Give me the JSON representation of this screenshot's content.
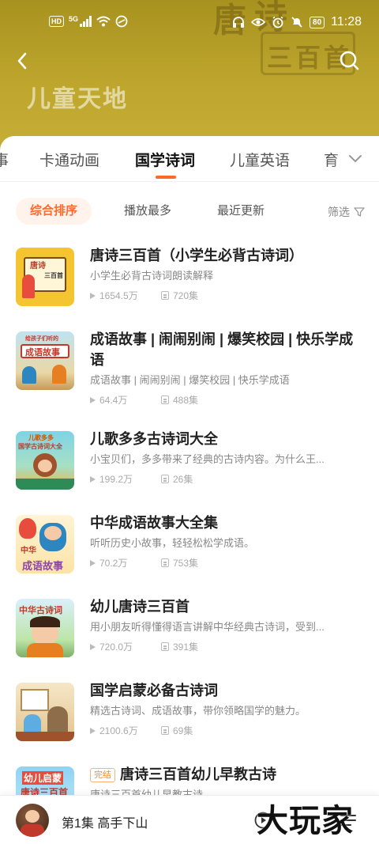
{
  "status_bar": {
    "network_badge": "HD",
    "network_type": "5G",
    "battery": "80",
    "time": "11:28"
  },
  "header": {
    "title": "儿童天地",
    "art_chars": [
      "唐",
      "诗",
      "三",
      "百",
      "首"
    ]
  },
  "tabs": {
    "items": [
      "事",
      "卡通动画",
      "国学诗词",
      "儿童英语",
      "育"
    ],
    "active": "国学诗词"
  },
  "sort": {
    "options": [
      "综合排序",
      "播放最多",
      "最近更新"
    ],
    "active": "综合排序",
    "filter_label": "筛选"
  },
  "list": [
    {
      "title": "唐诗三百首（小学生必背古诗词）",
      "description": "小学生必背古诗词朗读解释",
      "plays": "1654.5万",
      "episodes": "720集",
      "thumb_text": [
        "唐诗",
        "三百首"
      ],
      "badge": ""
    },
    {
      "title": "成语故事 | 闹闹别闹 | 爆笑校园 | 快乐学成语",
      "description": "成语故事 | 闹闹别闹 | 爆笑校园 | 快乐学成语",
      "plays": "64.4万",
      "episodes": "488集",
      "thumb_text": [
        "给孩子们听的",
        "成语故事"
      ],
      "badge": ""
    },
    {
      "title": "儿歌多多古诗词大全",
      "description": "小宝贝们，多多带来了经典的古诗内容。为什么王...",
      "plays": "199.2万",
      "episodes": "26集",
      "thumb_text": [
        "儿歌多多",
        "国学古诗词大全"
      ],
      "badge": ""
    },
    {
      "title": "中华成语故事大全集",
      "description": "听听历史小故事，轻轻松松学成语。",
      "plays": "70.2万",
      "episodes": "753集",
      "thumb_text": [
        "中华",
        "成语故事"
      ],
      "badge": ""
    },
    {
      "title": "幼儿唐诗三百首",
      "description": "用小朋友听得懂得语言讲解中华经典古诗词，受到...",
      "plays": "720.0万",
      "episodes": "391集",
      "thumb_text": [
        "中华古诗词"
      ],
      "badge": ""
    },
    {
      "title": "国学启蒙必备古诗词",
      "description": "精选古诗词、成语故事，带你领略国学的魅力。",
      "plays": "2100.6万",
      "episodes": "69集",
      "thumb_text": [],
      "badge": ""
    },
    {
      "title": "唐诗三百首幼儿早教古诗",
      "description": "唐诗三百首幼儿早教古诗",
      "plays": "",
      "episodes": "",
      "thumb_text": [
        "幼儿启蒙",
        "唐诗三百首"
      ],
      "badge": "完结"
    }
  ],
  "player": {
    "now_playing": "第1集 高手下山"
  },
  "watermark": "大玩家",
  "colors": {
    "accent": "#ff6a2b",
    "header_bg": "#b9a22b"
  }
}
